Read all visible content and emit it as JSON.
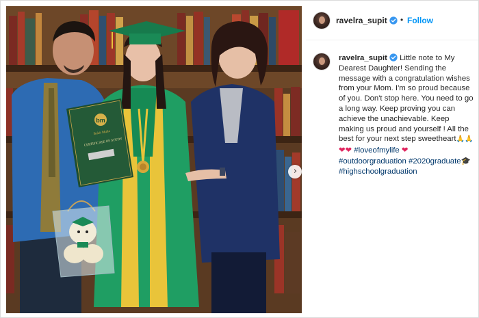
{
  "post": {
    "username": "ravelra_supit",
    "follow_label": "Follow",
    "separator": "•",
    "caption_text": "Little note to My Dearest Daughter! Sending the message with a congratulation wishes from your Mom. I'm so proud because of you. Don't stop here. You need to go a long way. Keep proving you can achieve the unachievable. Keep making us proud and yourself ! All the best for your next step sweetheart",
    "caption_emojis": {
      "hands": "🙏🙏",
      "hearts": "❤❤",
      "heart_single": "❤",
      "cap": "🎓"
    },
    "hashtags": [
      "#loveofmylife",
      "#outdoorgraduation",
      "#2020graduate",
      "#highschoolgraduation"
    ],
    "photo": {
      "certificate_logo": "bm",
      "certificate_school": "Bukit Mulia",
      "certificate_title": "CERTIFICATE OF STUDY"
    },
    "colors": {
      "follow": "#0095f6",
      "hashtag": "#00376b",
      "gown": "#1f9e63",
      "gown_trim": "#e9c43a"
    },
    "icons": {
      "verified": "verified-badge-icon",
      "carousel": "chevron-right-icon"
    }
  }
}
